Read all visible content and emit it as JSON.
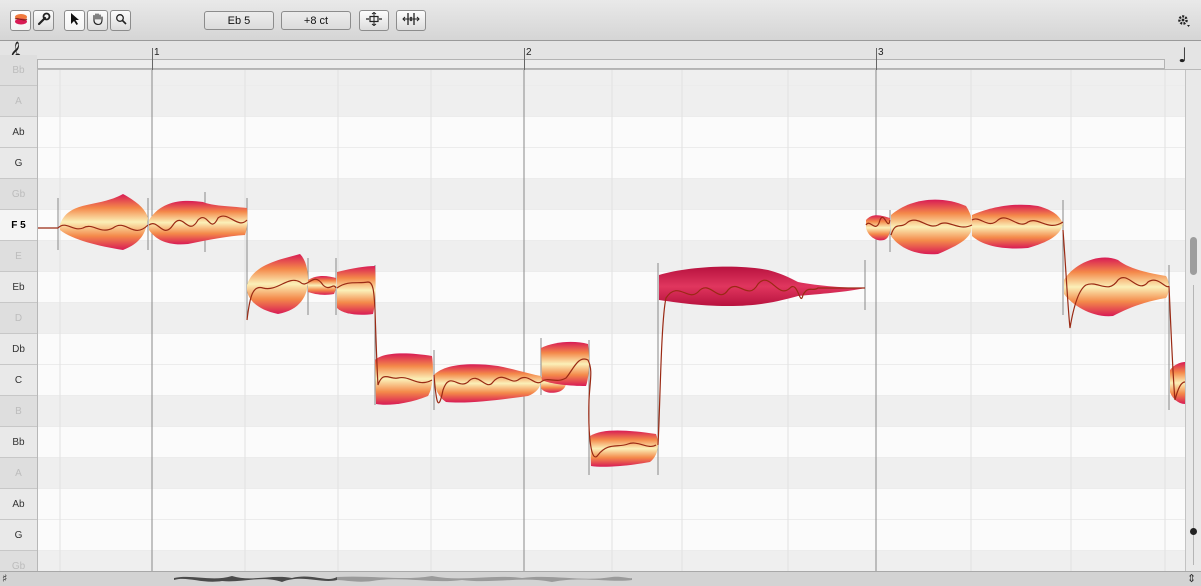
{
  "toolbar": {
    "tools": [
      {
        "name": "main-tool-icon",
        "selected": true
      },
      {
        "name": "wrench-icon",
        "selected": false
      },
      {
        "name": "arrow-pointer-icon",
        "selected": true
      },
      {
        "name": "hand-icon",
        "selected": false
      },
      {
        "name": "magnifier-icon",
        "selected": false
      }
    ],
    "pitch_value": "Eb 5",
    "cents_value": "+8 ct",
    "action_icons": [
      "pitch-align-icon",
      "time-align-icon"
    ],
    "settings_icon": "gear-icon"
  },
  "ruler": {
    "bars": [
      "1",
      "2",
      "3"
    ],
    "clef_icon": "treble-clef-icon",
    "note_icon": "quarter-note-icon"
  },
  "keyboard": {
    "keys": [
      {
        "label": "Bb",
        "black": true
      },
      {
        "label": "A",
        "black": true
      },
      {
        "label": "Ab",
        "black": false
      },
      {
        "label": "G",
        "black": false
      },
      {
        "label": "Gb",
        "black": true
      },
      {
        "label": "F 5",
        "black": false,
        "current": true
      },
      {
        "label": "E",
        "black": true
      },
      {
        "label": "Eb",
        "black": false
      },
      {
        "label": "D",
        "black": true
      },
      {
        "label": "Db",
        "black": false
      },
      {
        "label": "C",
        "black": false
      },
      {
        "label": "B",
        "black": true
      },
      {
        "label": "Bb",
        "black": false
      },
      {
        "label": "A",
        "black": true
      },
      {
        "label": "Ab",
        "black": false
      },
      {
        "label": "G",
        "black": false
      },
      {
        "label": "Gb",
        "black": true
      }
    ]
  },
  "notes": [
    {
      "pitch": "F 5",
      "start": 0.07,
      "end": 0.8,
      "selected": false
    },
    {
      "pitch": "Eb",
      "start": 0.8,
      "end": 1.2,
      "selected": false
    },
    {
      "pitch": "C",
      "start": 1.2,
      "end": 2.0,
      "selected": false
    },
    {
      "pitch": "Db",
      "start": 2.0,
      "end": 2.15,
      "selected": false
    },
    {
      "pitch": "Bb",
      "start": 2.15,
      "end": 2.39,
      "selected": false
    },
    {
      "pitch": "Eb",
      "start": 2.39,
      "end": 2.97,
      "selected": true
    },
    {
      "pitch": "F 5",
      "start": 2.97,
      "end": 3.57,
      "selected": false
    },
    {
      "pitch": "Eb",
      "start": 3.57,
      "end": 3.9,
      "selected": false
    },
    {
      "pitch": "C",
      "start": 3.9,
      "end": 4.0,
      "selected": false
    }
  ],
  "colors": {
    "blob_edge": "#d81b55",
    "blob_mid": "#f4894a",
    "blob_core": "#fbf0b8",
    "selected_blob": "#d0284e",
    "pitch_curve": "#9a2a14"
  }
}
